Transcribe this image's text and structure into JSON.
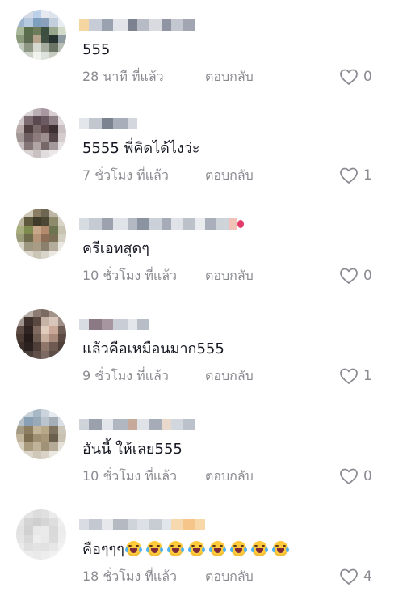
{
  "comments": [
    {
      "username": "",
      "text": "555",
      "time": "28 นาที ที่แล้ว",
      "reply_label": "ตอบกลับ",
      "likes": "0",
      "avatar_colors": [
        "#c9d6e8",
        "#d5dbe6",
        "#bcd0ea",
        "#e6eaf0",
        "#dde4ec",
        "#f2f4f7",
        "#9fb4cf",
        "#b7c9de",
        "#7f9fbe",
        "#8aa1bd",
        "#c3cfdc",
        "#e9edf2",
        "#a9b89a",
        "#5b6e4b",
        "#6c7b5a",
        "#3d4f3e",
        "#98a68e",
        "#d2dac9",
        "#8b9a7a",
        "#5c6a50",
        "#b5a28a",
        "#3f5042",
        "#263330",
        "#8d9aa0",
        "#c0c8bb",
        "#8e9684",
        "#d5d9cf",
        "#a7ad9e",
        "#6a7566",
        "#b8beb5",
        "#e6e9e3",
        "#cfd4cb",
        "#f0f2ee",
        "#dfe2dc",
        "#c7ccc3",
        "#eef0ec"
      ],
      "name_colors": [
        "#f5d6a1",
        "#c8ccd6",
        "#9aa2b0",
        "#e2e4e9",
        "#7c8290",
        "#b6bbc6",
        "#d9dbe1",
        "#8f95a2",
        "#c3c7d0",
        "#a1a6b2"
      ]
    },
    {
      "username": "",
      "text": "5555 พี่คิดได้ไงว่ะ",
      "time": "7 ชั่วโมง ที่แล้ว",
      "reply_label": "ตอบกลับ",
      "likes": "1",
      "avatar_colors": [
        "#e9e6e6",
        "#d8d2d4",
        "#b9aeb3",
        "#a8979f",
        "#d6cdd0",
        "#f1eeef",
        "#cfc6c9",
        "#7d6d72",
        "#5a4a50",
        "#6b5a61",
        "#8f8086",
        "#e2dcde",
        "#b8aaa8",
        "#4e3e40",
        "#7a6a6a",
        "#5a4648",
        "#3d3032",
        "#c9bfc0",
        "#a39898",
        "#6e6062",
        "#8c7c7e",
        "#9d8e8f",
        "#554649",
        "#d4cccd",
        "#c6bdbe",
        "#857678",
        "#b0a4a5",
        "#766869",
        "#a59a9b",
        "#e6e1e2",
        "#eeebeb",
        "#d9d3d4",
        "#c9c1c2",
        "#e1dcdd",
        "#ebe7e8",
        "#f4f2f2"
      ],
      "name_colors": [
        "#e3e6ea",
        "#c2c7cf",
        "#7b8390",
        "#a9afba",
        "#d4d8de"
      ]
    },
    {
      "username": "",
      "text": "ครีเอทสุดๆ",
      "time": "10 ชั่วโมง ที่แล้ว",
      "reply_label": "ตอบกลับ",
      "likes": "0",
      "avatar_colors": [
        "#e6e3dc",
        "#cfc8b8",
        "#8a7d63",
        "#6f6752",
        "#bdb6a4",
        "#eeebe5",
        "#b9b29c",
        "#5f5a3d",
        "#3f3a2a",
        "#4c4735",
        "#8e8a6c",
        "#d8d4c7",
        "#a7ad7c",
        "#7d8b4e",
        "#c8a68a",
        "#b48a6c",
        "#6c7550",
        "#c7c3b0",
        "#9a9c7c",
        "#6e6a4c",
        "#b69478",
        "#8e6e56",
        "#7b6f56",
        "#d3cfc0",
        "#d5d2c6",
        "#9e9782",
        "#a89c86",
        "#8b806d",
        "#b4ad9b",
        "#ebe8e1",
        "#f2f0eb",
        "#dcd8cd",
        "#cbc5b6",
        "#d9d4c9",
        "#ebe8e2",
        "#f5f3ef"
      ],
      "name_colors": [
        "#d7dbe2",
        "#c5cad3",
        "#9ca3af",
        "#e0e3e8",
        "#b3b9c3",
        "#8c93a0",
        "#ccd0d8",
        "#a6acb7",
        "#dfe2e7",
        "#bcc1ca",
        "#e9ebef",
        "#aab0bb",
        "#cfd3da",
        "#f1c3b8",
        "#e33a6a"
      ]
    },
    {
      "username": "",
      "text": "แล้วคือเหมือนมาก555",
      "time": "9 ชั่วโมง ที่แล้ว",
      "reply_label": "ตอบกลับ",
      "likes": "1",
      "avatar_colors": [
        "#d6d0cd",
        "#b9ada7",
        "#8c7c74",
        "#7a6a62",
        "#a1928a",
        "#e0dbd8",
        "#a1958f",
        "#3e302a",
        "#5a4740",
        "#c7b3a6",
        "#d9c6ba",
        "#9d8f88",
        "#5b4b44",
        "#2f2420",
        "#806a5f",
        "#e0cbbd",
        "#caa898",
        "#6d5c54",
        "#4a3b35",
        "#251c19",
        "#6d5a50",
        "#c8ae9e",
        "#a98a7a",
        "#5b4a43",
        "#3d302b",
        "#2b211e",
        "#4d3e38",
        "#8e776a",
        "#6e5a50",
        "#4e3f39",
        "#6b5d57",
        "#4a3e39",
        "#605049",
        "#7d6b62",
        "#5d4e48",
        "#7b6d67"
      ],
      "name_colors": [
        "#d8dce3",
        "#8b7a84",
        "#a7969f",
        "#c9ced6",
        "#e3e6ea",
        "#b8bec8"
      ]
    },
    {
      "username": "",
      "text": "อันนี้ ให้เลย555",
      "time": "10 ชั่วโมง ที่แล้ว",
      "reply_label": "ตอบกลับ",
      "likes": "0",
      "avatar_colors": [
        "#dde3e8",
        "#c7d1da",
        "#a9b8c6",
        "#cbd4dd",
        "#e6eaef",
        "#f2f4f6",
        "#b4bfc8",
        "#8aa0b4",
        "#98a9b8",
        "#b9c4ce",
        "#a4aeb7",
        "#d8dee3",
        "#a59a84",
        "#8d7e62",
        "#c2b59a",
        "#b8a888",
        "#7e7460",
        "#ccc6b8",
        "#c1b69c",
        "#7d6e52",
        "#9e8f72",
        "#a99877",
        "#6a5f4c",
        "#c9c2b2",
        "#d6cfbd",
        "#a89b80",
        "#bfb39a",
        "#9f9277",
        "#b4aa95",
        "#e6e2d9",
        "#efece5",
        "#dcd6ca",
        "#cfc8b9",
        "#d9d3c7",
        "#ebe8e1",
        "#f4f2ed"
      ],
      "name_colors": [
        "#cfd4db",
        "#9aa1ad",
        "#e2e5ea",
        "#b1b7c1",
        "#c6a99a",
        "#dfe2e7",
        "#a7adb8",
        "#e9d9cc",
        "#d2d6dd",
        "#bcc2cb"
      ]
    },
    {
      "username": "",
      "text": "คือๆๆๆ",
      "emoji_count": 8,
      "time": "18 ชั่วโมง ที่แล้ว",
      "reply_label": "ตอบกลับ",
      "likes": "4",
      "avatar_colors": [
        "#f0f0f0",
        "#e4e4e4",
        "#dcdcdc",
        "#e0e0e0",
        "#ebebeb",
        "#f5f5f5",
        "#e6e6e6",
        "#d4d4d4",
        "#cfcfcf",
        "#d6d6d6",
        "#dedede",
        "#efefef",
        "#e2e2e2",
        "#d1d1d1",
        "#e8e8e8",
        "#eaeaea",
        "#d9d9d9",
        "#ececec",
        "#e5e5e5",
        "#d8d8d8",
        "#ededed",
        "#e9e9e9",
        "#dbdbdb",
        "#eeeeee",
        "#ebebeb",
        "#dfdfdf",
        "#e3e3e3",
        "#e1e1e1",
        "#e7e7e7",
        "#f2f2f2",
        "#f4f4f4",
        "#ececec",
        "#e9e9e9",
        "#ededed",
        "#f1f1f1",
        "#f7f7f7"
      ],
      "name_colors": [
        "#d9dce2",
        "#c4c8d0",
        "#e6e8ec",
        "#b4b9c2",
        "#cfd3da",
        "#dde0e5",
        "#c8ccd3",
        "#e2e5e9",
        "#f7d9b0",
        "#f5c58a",
        "#f8d7a8"
      ]
    }
  ],
  "colors": {
    "text_primary": "#161823",
    "text_secondary": "#8a8b91",
    "heart_stroke": "#8a8b91"
  },
  "icons": {
    "like": "heart-outline-icon"
  }
}
